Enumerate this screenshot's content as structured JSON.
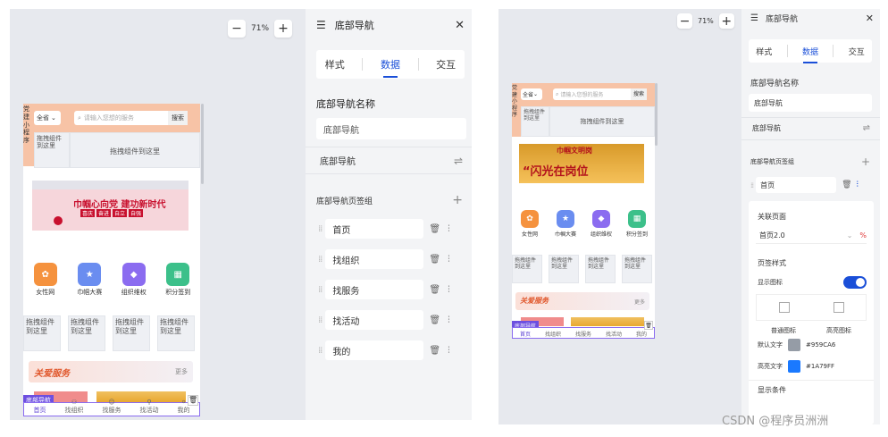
{
  "zoom": {
    "minus": "−",
    "level": "71%",
    "plus": "+"
  },
  "panel": {
    "title": "底部导航",
    "close": "✕",
    "tabs": [
      "样式",
      "数据",
      "交互"
    ],
    "name_label": "底部导航名称",
    "name_value": "底部导航",
    "section": "底部导航",
    "group_label": "底部导航页签组",
    "items": [
      "首页",
      "找组织",
      "找服务",
      "找活动",
      "我的"
    ]
  },
  "phone1": {
    "side_text": "党建小程序",
    "city": "全省",
    "search_placeholder": "请输入您想的服务",
    "search_btn": "搜索",
    "drag_tip1": "拖拽组件到这里",
    "drag_tip2": "拖拽组件到这里",
    "banner_text": "巾帼心向党 建功新时代",
    "banner_chips": [
      "喜庆",
      "奋进",
      "自立",
      "自强"
    ],
    "icons": [
      {
        "label": "女性网",
        "color": "#f5923e"
      },
      {
        "label": "巾帼大赛",
        "color": "#6a8df0"
      },
      {
        "label": "组织维权",
        "color": "#8b6cf0"
      },
      {
        "label": "积分签到",
        "color": "#3cc08a"
      }
    ],
    "cells": [
      "拖拽组件到这里",
      "拖拽组件到这里",
      "拖拽组件到这里",
      "拖拽组件到这里"
    ],
    "service_title": "关爱服务",
    "more": "更多",
    "nav_label": "底部导航",
    "nav": [
      "首页",
      "找组织",
      "找服务",
      "找活动",
      "我的"
    ]
  },
  "right": {
    "zoom": {
      "minus": "−",
      "level": "71%",
      "plus": "+"
    },
    "title": "底部导航",
    "close": "✕",
    "tabs": [
      "样式",
      "数据",
      "交互"
    ],
    "name_label": "底部导航名称",
    "name_value": "底部导航",
    "section": "底部导航",
    "group_label": "底部导航页签组",
    "item": "首页",
    "link_label": "关联页面",
    "link_value": "首页2.0",
    "style_label": "页签样式",
    "show_icon": "显示图标",
    "normal_icon": "普通图标",
    "active_icon": "高亮图标",
    "default_text": "默认文字",
    "default_color": "#959CA6",
    "active_text": "高亮文字",
    "active_color": "#1A79FF",
    "cond": "显示条件"
  },
  "phone2": {
    "side_text": "党建小程序",
    "city": "全省",
    "search_placeholder": "请输入您想的服务",
    "search_btn": "搜索",
    "drag_tip1": "拖拽组件到这里",
    "drag_tip2": "拖拽组件到这里",
    "banner_text1": "巾帼文明岗",
    "banner_text2": "“闪光在岗位",
    "icons": [
      {
        "label": "女性网",
        "color": "#f5923e"
      },
      {
        "label": "巾帼大赛",
        "color": "#6a8df0"
      },
      {
        "label": "组织维权",
        "color": "#8b6cf0"
      },
      {
        "label": "积分签到",
        "color": "#3cc08a"
      }
    ],
    "cells": [
      "拖拽组件到这里",
      "拖拽组件到这里",
      "拖拽组件到这里",
      "拖拽组件到这里"
    ],
    "service_title": "关爱服务",
    "more": "更多",
    "nav_label": "底部导航",
    "nav": [
      "首页",
      "找组织",
      "找服务",
      "找活动",
      "我的"
    ]
  },
  "watermark": "CSDN @程序员洲洲"
}
